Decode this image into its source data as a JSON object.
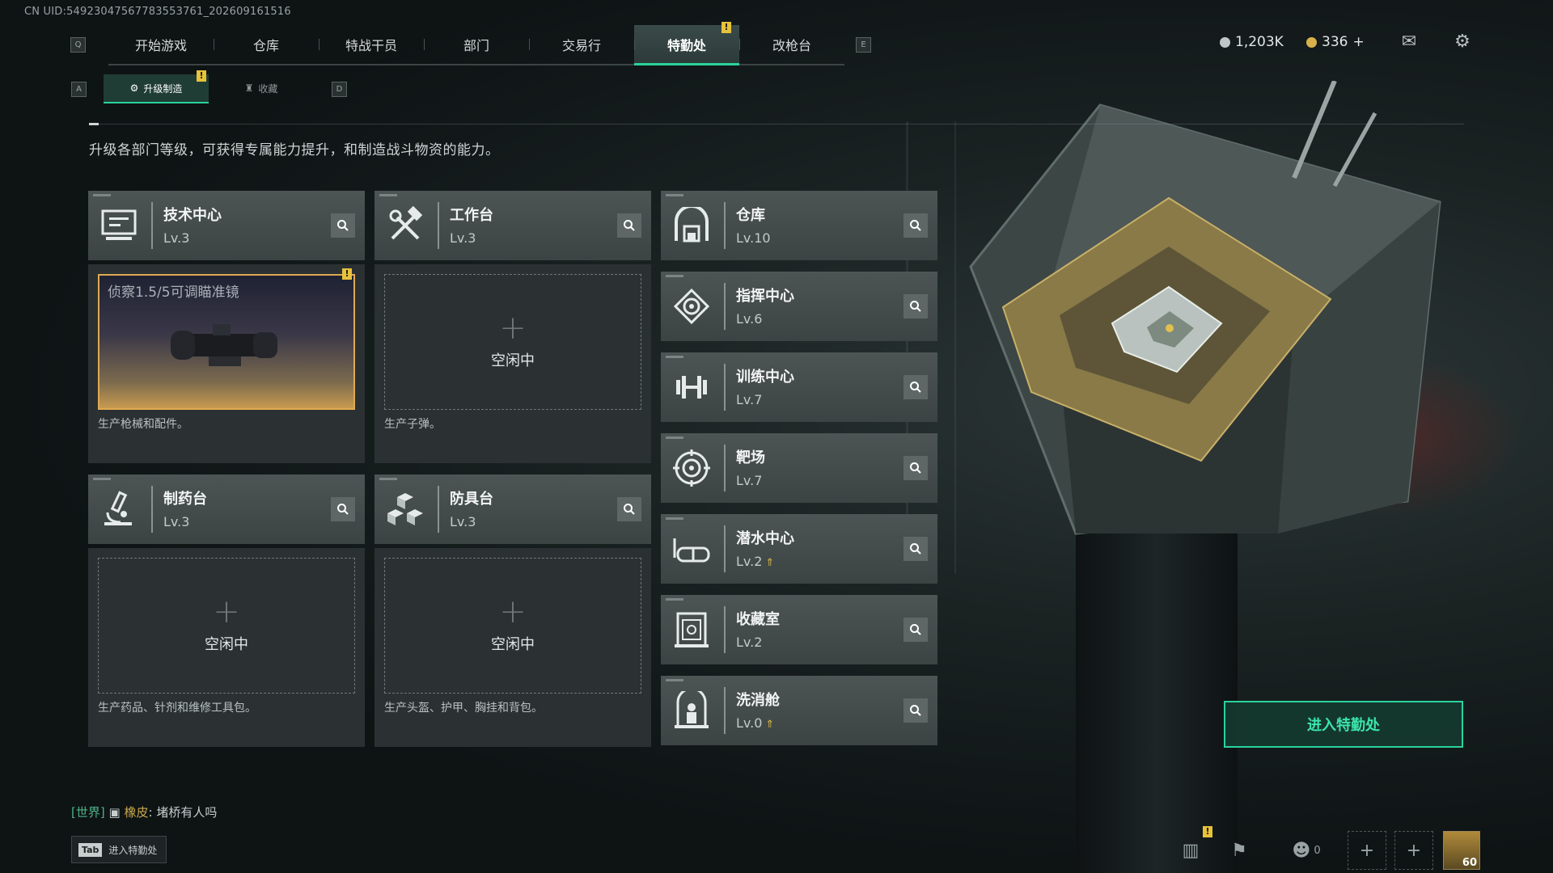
{
  "uid": "CN UID:54923047567783553761_202609161516",
  "top_tabs": {
    "key_left": "Q",
    "key_right": "E",
    "items": [
      {
        "label": "开始游戏"
      },
      {
        "label": "仓库"
      },
      {
        "label": "特战干员"
      },
      {
        "label": "部门"
      },
      {
        "label": "交易行"
      },
      {
        "label": "特勤处",
        "active": true
      },
      {
        "label": "改枪台"
      }
    ]
  },
  "sub_tabs": {
    "key_left": "A",
    "key_right": "D",
    "items": [
      {
        "label": "升级制造",
        "active": true
      },
      {
        "label": "收藏"
      }
    ]
  },
  "currency": {
    "silver": "1,203K",
    "gold": "336",
    "add": "+"
  },
  "warn_mark": "!",
  "description": "升级各部门等级，可获得专属能力提升，和制造战斗物资的能力。",
  "production": [
    {
      "name": "技术中心",
      "level": "Lv.3",
      "icon": "computer-icon",
      "item_name": "侦察1.5/5可调瞄准镜",
      "desc": "生产枪械和配件。",
      "has_item": true
    },
    {
      "name": "工作台",
      "level": "Lv.3",
      "icon": "tools-icon",
      "idle": "空闲中",
      "plus": "+",
      "desc": "生产子弹。"
    },
    {
      "name": "制药台",
      "level": "Lv.3",
      "icon": "microscope-icon",
      "idle": "空闲中",
      "plus": "+",
      "desc": "生产药品、针剂和维修工具包。"
    },
    {
      "name": "防具台",
      "level": "Lv.3",
      "icon": "cubes-icon",
      "idle": "空闲中",
      "plus": "+",
      "desc": "生产头盔、护甲、胸挂和背包。"
    }
  ],
  "departments": [
    {
      "name": "仓库",
      "level": "Lv.10",
      "icon": "warehouse-icon"
    },
    {
      "name": "指挥中心",
      "level": "Lv.6",
      "icon": "command-icon"
    },
    {
      "name": "训练中心",
      "level": "Lv.7",
      "icon": "dumbbell-icon"
    },
    {
      "name": "靶场",
      "level": "Lv.7",
      "icon": "target-icon"
    },
    {
      "name": "潜水中心",
      "level": "Lv.2",
      "icon": "dive-mask-icon",
      "upgrade": true
    },
    {
      "name": "收藏室",
      "level": "Lv.2",
      "icon": "collection-icon"
    },
    {
      "name": "洗消舱",
      "level": "Lv.0",
      "icon": "decon-icon",
      "upgrade": true
    }
  ],
  "enter_button": "进入特勤处",
  "chat": {
    "channel": "[世界]",
    "name": "橡皮",
    "message": "堵桥有人吗"
  },
  "tab_hint": {
    "key": "Tab",
    "label": "进入特勤处"
  },
  "bottom_bar": {
    "friends_count": "0",
    "avatar_level": "60"
  }
}
